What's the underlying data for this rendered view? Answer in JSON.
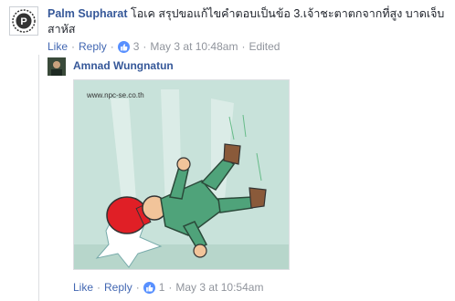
{
  "comment1": {
    "author": "Palm Supharat",
    "text": "โอเค สรุปขอแก้ไขคำตอบเป็นข้อ 3.เจ้าชะตาตกจากที่สูง บาดเจ็บสาหัส",
    "actions": {
      "like": "Like",
      "reply": "Reply",
      "reaction_count": "3",
      "timestamp": "May 3 at 10:48am",
      "edited": "Edited"
    }
  },
  "comment2": {
    "author": "Amnad Wungnatun",
    "image_watermark": "www.npc-se.co.th",
    "actions": {
      "like": "Like",
      "reply": "Reply",
      "reaction_count": "1",
      "timestamp": "May 3 at 10:54am"
    }
  },
  "icons": {
    "avatar1": "p-logo-avatar",
    "like_badge": "thumbs-up-icon"
  },
  "colors": {
    "link": "#365899",
    "action_link": "#4267b2",
    "meta": "#90949c",
    "like_badge": "#5890ff"
  }
}
